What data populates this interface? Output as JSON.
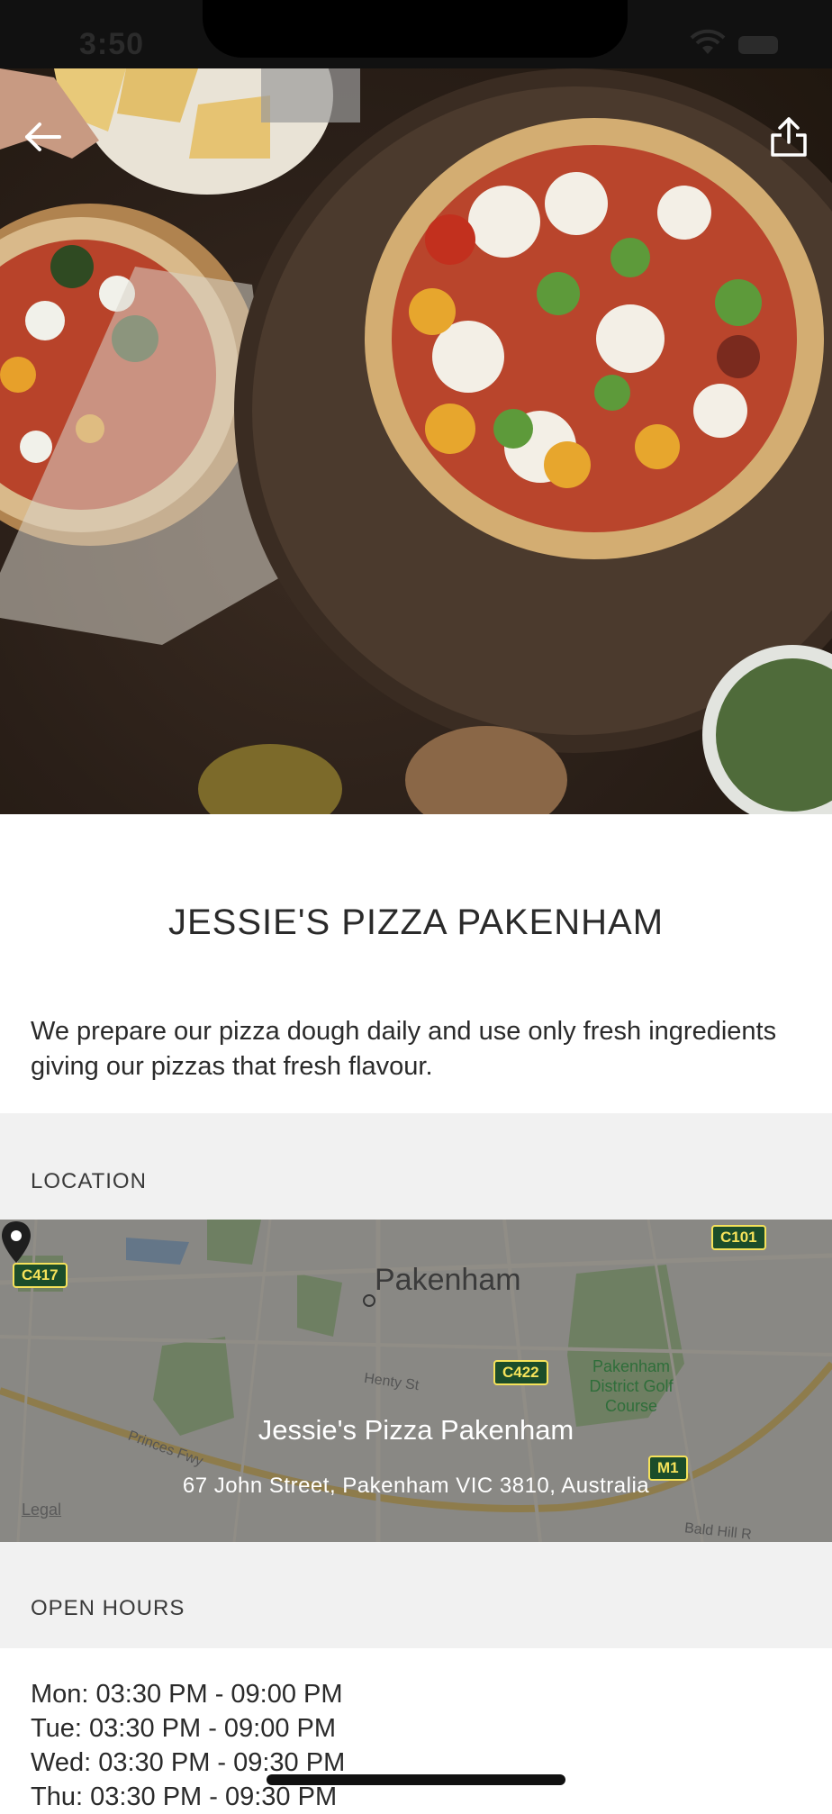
{
  "status_bar": {
    "time": "3:50"
  },
  "hero": {
    "image_alt": "Pizzas on wooden boards"
  },
  "restaurant": {
    "name": "JESSIE'S PIZZA PAKENHAM",
    "description": "We prepare our pizza dough daily and use only fresh ingredients giving our pizzas that fresh flavour."
  },
  "location": {
    "header": "LOCATION",
    "map": {
      "town_label": "Pakenham",
      "venue_name": "Jessie's Pizza Pakenham",
      "address": "67 John Street, Pakenham VIC 3810, Australia",
      "legal": "Legal",
      "roads": {
        "c417": "C417",
        "c101": "C101",
        "c422": "C422",
        "m1": "M1"
      },
      "places": {
        "golf": "Pakenham District Golf Course"
      },
      "streets": {
        "princes": "Princes Fwy",
        "henty": "Henty St",
        "bald_hill": "Bald Hill R"
      }
    }
  },
  "hours": {
    "header": "OPEN HOURS",
    "rows": [
      "Mon: 03:30 PM - 09:00 PM",
      "Tue: 03:30 PM - 09:00 PM",
      "Wed: 03:30 PM - 09:30 PM",
      "Thu: 03:30 PM - 09:30 PM"
    ]
  },
  "colors": {
    "section_bg": "#f1f1f1",
    "text": "#2a2a2a",
    "road_badge": "#1b4d2a"
  },
  "icons": {
    "back": "back-arrow-icon",
    "share": "share-icon",
    "pin": "map-pin-icon"
  }
}
